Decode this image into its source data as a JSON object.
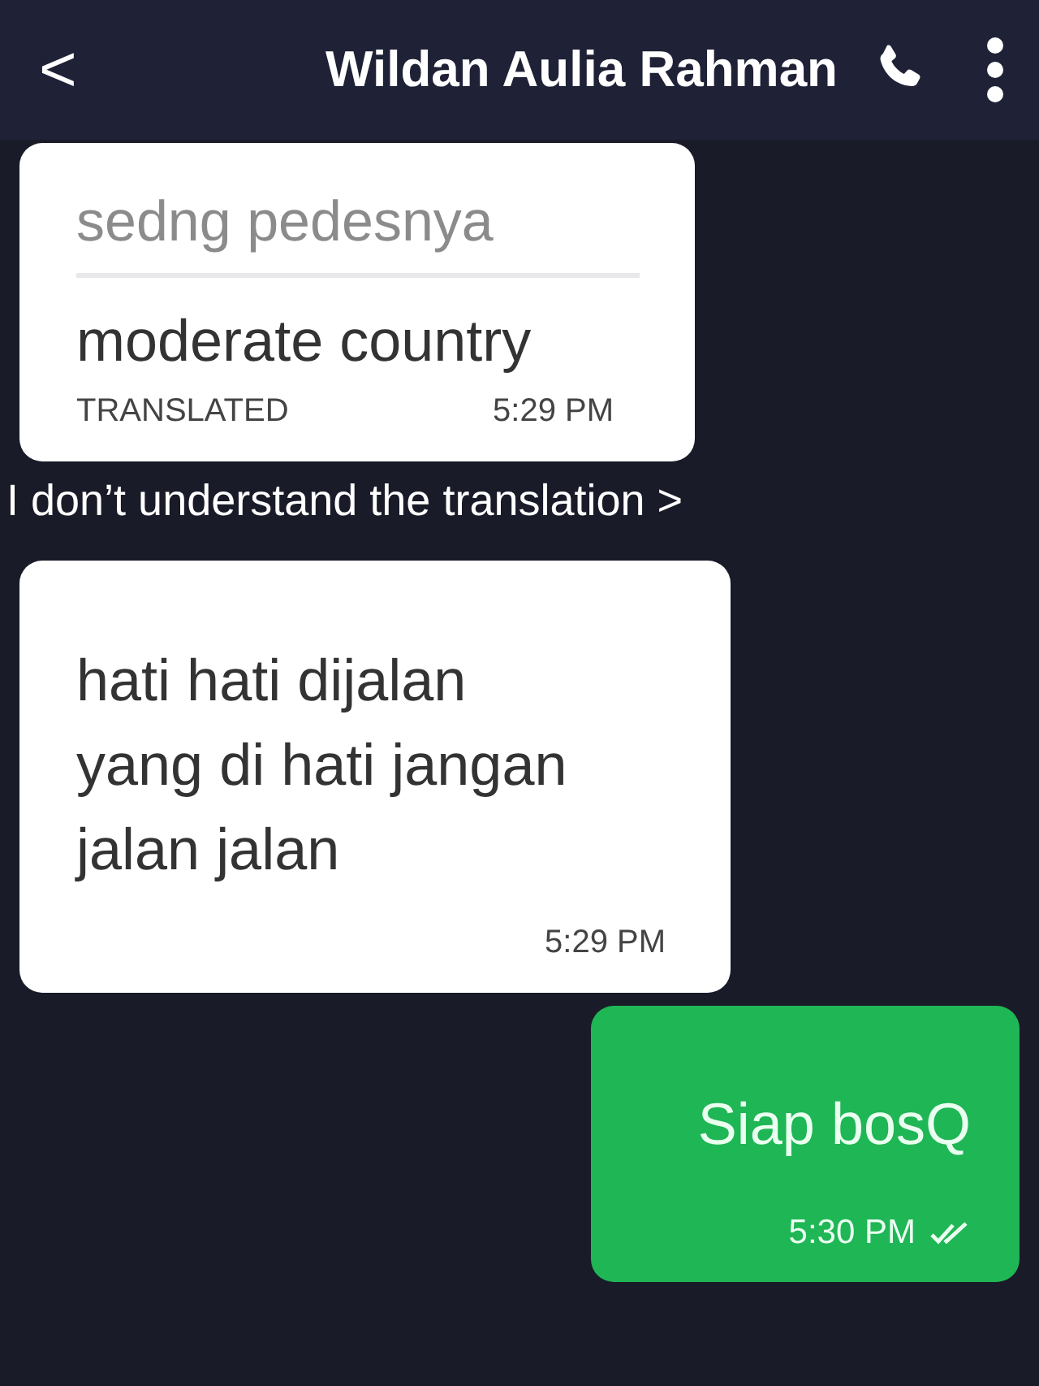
{
  "header": {
    "back": "<",
    "title": "Wildan Aulia Rahman"
  },
  "messages": [
    {
      "kind": "translated",
      "original": "sedng pedesnya",
      "translation": "moderate country",
      "label": "TRANSLATED",
      "time": "5:29 PM"
    },
    {
      "kind": "link",
      "text": "I don’t understand the translation >"
    },
    {
      "kind": "incoming",
      "lines": [
        "hati hati dijalan",
        "yang di hati jangan",
        "jalan jalan"
      ],
      "time": "5:29 PM"
    },
    {
      "kind": "outgoing",
      "text": "Siap bosQ",
      "time": "5:30 PM",
      "read": true
    }
  ]
}
